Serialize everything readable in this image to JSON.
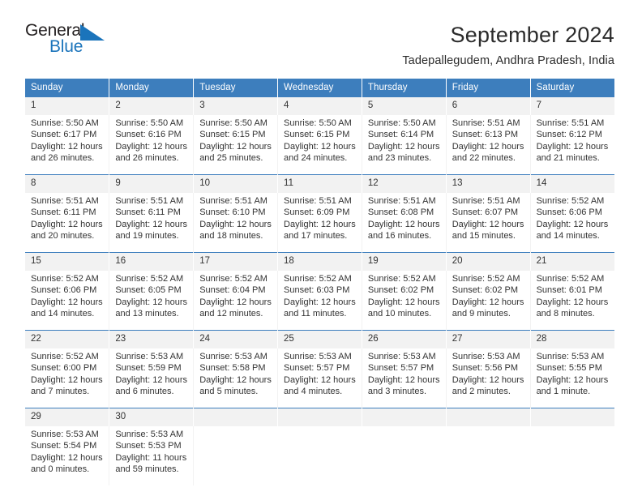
{
  "logo": {
    "word1": "General",
    "word2": "Blue",
    "triangle_color": "#1b74bb",
    "text_color": "#231f20"
  },
  "header": {
    "title": "September 2024",
    "subtitle": "Tadepallegudem, Andhra Pradesh, India"
  },
  "theme": {
    "header_row_bg": "#3d7ebd",
    "daynum_bg": "#f2f2f2",
    "accent": "#1b74bb",
    "text": "#333333"
  },
  "calendar": {
    "weekday_headers": [
      "Sunday",
      "Monday",
      "Tuesday",
      "Wednesday",
      "Thursday",
      "Friday",
      "Saturday"
    ],
    "weeks": [
      [
        {
          "day": "1",
          "sunrise": "Sunrise: 5:50 AM",
          "sunset": "Sunset: 6:17 PM",
          "daylight1": "Daylight: 12 hours",
          "daylight2": "and 26 minutes."
        },
        {
          "day": "2",
          "sunrise": "Sunrise: 5:50 AM",
          "sunset": "Sunset: 6:16 PM",
          "daylight1": "Daylight: 12 hours",
          "daylight2": "and 26 minutes."
        },
        {
          "day": "3",
          "sunrise": "Sunrise: 5:50 AM",
          "sunset": "Sunset: 6:15 PM",
          "daylight1": "Daylight: 12 hours",
          "daylight2": "and 25 minutes."
        },
        {
          "day": "4",
          "sunrise": "Sunrise: 5:50 AM",
          "sunset": "Sunset: 6:15 PM",
          "daylight1": "Daylight: 12 hours",
          "daylight2": "and 24 minutes."
        },
        {
          "day": "5",
          "sunrise": "Sunrise: 5:50 AM",
          "sunset": "Sunset: 6:14 PM",
          "daylight1": "Daylight: 12 hours",
          "daylight2": "and 23 minutes."
        },
        {
          "day": "6",
          "sunrise": "Sunrise: 5:51 AM",
          "sunset": "Sunset: 6:13 PM",
          "daylight1": "Daylight: 12 hours",
          "daylight2": "and 22 minutes."
        },
        {
          "day": "7",
          "sunrise": "Sunrise: 5:51 AM",
          "sunset": "Sunset: 6:12 PM",
          "daylight1": "Daylight: 12 hours",
          "daylight2": "and 21 minutes."
        }
      ],
      [
        {
          "day": "8",
          "sunrise": "Sunrise: 5:51 AM",
          "sunset": "Sunset: 6:11 PM",
          "daylight1": "Daylight: 12 hours",
          "daylight2": "and 20 minutes."
        },
        {
          "day": "9",
          "sunrise": "Sunrise: 5:51 AM",
          "sunset": "Sunset: 6:11 PM",
          "daylight1": "Daylight: 12 hours",
          "daylight2": "and 19 minutes."
        },
        {
          "day": "10",
          "sunrise": "Sunrise: 5:51 AM",
          "sunset": "Sunset: 6:10 PM",
          "daylight1": "Daylight: 12 hours",
          "daylight2": "and 18 minutes."
        },
        {
          "day": "11",
          "sunrise": "Sunrise: 5:51 AM",
          "sunset": "Sunset: 6:09 PM",
          "daylight1": "Daylight: 12 hours",
          "daylight2": "and 17 minutes."
        },
        {
          "day": "12",
          "sunrise": "Sunrise: 5:51 AM",
          "sunset": "Sunset: 6:08 PM",
          "daylight1": "Daylight: 12 hours",
          "daylight2": "and 16 minutes."
        },
        {
          "day": "13",
          "sunrise": "Sunrise: 5:51 AM",
          "sunset": "Sunset: 6:07 PM",
          "daylight1": "Daylight: 12 hours",
          "daylight2": "and 15 minutes."
        },
        {
          "day": "14",
          "sunrise": "Sunrise: 5:52 AM",
          "sunset": "Sunset: 6:06 PM",
          "daylight1": "Daylight: 12 hours",
          "daylight2": "and 14 minutes."
        }
      ],
      [
        {
          "day": "15",
          "sunrise": "Sunrise: 5:52 AM",
          "sunset": "Sunset: 6:06 PM",
          "daylight1": "Daylight: 12 hours",
          "daylight2": "and 14 minutes."
        },
        {
          "day": "16",
          "sunrise": "Sunrise: 5:52 AM",
          "sunset": "Sunset: 6:05 PM",
          "daylight1": "Daylight: 12 hours",
          "daylight2": "and 13 minutes."
        },
        {
          "day": "17",
          "sunrise": "Sunrise: 5:52 AM",
          "sunset": "Sunset: 6:04 PM",
          "daylight1": "Daylight: 12 hours",
          "daylight2": "and 12 minutes."
        },
        {
          "day": "18",
          "sunrise": "Sunrise: 5:52 AM",
          "sunset": "Sunset: 6:03 PM",
          "daylight1": "Daylight: 12 hours",
          "daylight2": "and 11 minutes."
        },
        {
          "day": "19",
          "sunrise": "Sunrise: 5:52 AM",
          "sunset": "Sunset: 6:02 PM",
          "daylight1": "Daylight: 12 hours",
          "daylight2": "and 10 minutes."
        },
        {
          "day": "20",
          "sunrise": "Sunrise: 5:52 AM",
          "sunset": "Sunset: 6:02 PM",
          "daylight1": "Daylight: 12 hours",
          "daylight2": "and 9 minutes."
        },
        {
          "day": "21",
          "sunrise": "Sunrise: 5:52 AM",
          "sunset": "Sunset: 6:01 PM",
          "daylight1": "Daylight: 12 hours",
          "daylight2": "and 8 minutes."
        }
      ],
      [
        {
          "day": "22",
          "sunrise": "Sunrise: 5:52 AM",
          "sunset": "Sunset: 6:00 PM",
          "daylight1": "Daylight: 12 hours",
          "daylight2": "and 7 minutes."
        },
        {
          "day": "23",
          "sunrise": "Sunrise: 5:53 AM",
          "sunset": "Sunset: 5:59 PM",
          "daylight1": "Daylight: 12 hours",
          "daylight2": "and 6 minutes."
        },
        {
          "day": "24",
          "sunrise": "Sunrise: 5:53 AM",
          "sunset": "Sunset: 5:58 PM",
          "daylight1": "Daylight: 12 hours",
          "daylight2": "and 5 minutes."
        },
        {
          "day": "25",
          "sunrise": "Sunrise: 5:53 AM",
          "sunset": "Sunset: 5:57 PM",
          "daylight1": "Daylight: 12 hours",
          "daylight2": "and 4 minutes."
        },
        {
          "day": "26",
          "sunrise": "Sunrise: 5:53 AM",
          "sunset": "Sunset: 5:57 PM",
          "daylight1": "Daylight: 12 hours",
          "daylight2": "and 3 minutes."
        },
        {
          "day": "27",
          "sunrise": "Sunrise: 5:53 AM",
          "sunset": "Sunset: 5:56 PM",
          "daylight1": "Daylight: 12 hours",
          "daylight2": "and 2 minutes."
        },
        {
          "day": "28",
          "sunrise": "Sunrise: 5:53 AM",
          "sunset": "Sunset: 5:55 PM",
          "daylight1": "Daylight: 12 hours",
          "daylight2": "and 1 minute."
        }
      ],
      [
        {
          "day": "29",
          "sunrise": "Sunrise: 5:53 AM",
          "sunset": "Sunset: 5:54 PM",
          "daylight1": "Daylight: 12 hours",
          "daylight2": "and 0 minutes."
        },
        {
          "day": "30",
          "sunrise": "Sunrise: 5:53 AM",
          "sunset": "Sunset: 5:53 PM",
          "daylight1": "Daylight: 11 hours",
          "daylight2": "and 59 minutes."
        },
        {
          "day": "",
          "sunrise": "",
          "sunset": "",
          "daylight1": "",
          "daylight2": ""
        },
        {
          "day": "",
          "sunrise": "",
          "sunset": "",
          "daylight1": "",
          "daylight2": ""
        },
        {
          "day": "",
          "sunrise": "",
          "sunset": "",
          "daylight1": "",
          "daylight2": ""
        },
        {
          "day": "",
          "sunrise": "",
          "sunset": "",
          "daylight1": "",
          "daylight2": ""
        },
        {
          "day": "",
          "sunrise": "",
          "sunset": "",
          "daylight1": "",
          "daylight2": ""
        }
      ]
    ]
  }
}
